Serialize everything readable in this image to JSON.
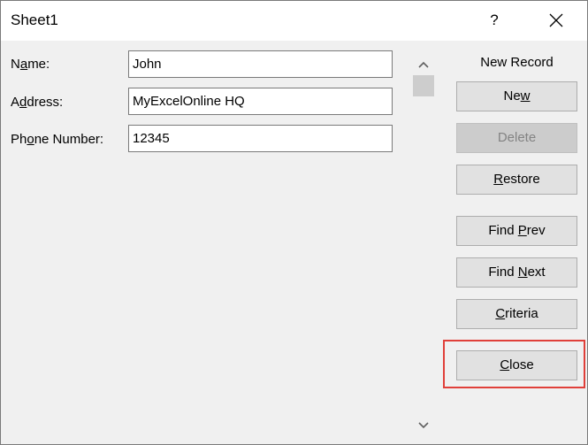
{
  "window": {
    "title": "Sheet1",
    "help_label": "?"
  },
  "fields": [
    {
      "label_pre": "N",
      "label_ul": "a",
      "label_post": "me:",
      "value": "John"
    },
    {
      "label_pre": "A",
      "label_ul": "d",
      "label_post": "dress:",
      "value": "MyExcelOnline HQ"
    },
    {
      "label_pre": "Ph",
      "label_ul": "o",
      "label_post": "ne Number:",
      "value": "12345"
    }
  ],
  "status": "New Record",
  "buttons": {
    "new": {
      "pre": "Ne",
      "ul": "w",
      "post": ""
    },
    "delete": {
      "pre": "",
      "ul": "",
      "post": "Delete"
    },
    "restore": {
      "pre": "",
      "ul": "R",
      "post": "estore"
    },
    "find_prev": {
      "pre": "Find ",
      "ul": "P",
      "post": "rev"
    },
    "find_next": {
      "pre": "Find ",
      "ul": "N",
      "post": "ext"
    },
    "criteria": {
      "pre": "",
      "ul": "C",
      "post": "riteria"
    },
    "close": {
      "pre": "",
      "ul": "C",
      "post": "lose"
    }
  },
  "colors": {
    "highlight_border": "#e0403a",
    "dialog_bg": "#f0f0f0",
    "button_bg": "#e1e1e1"
  }
}
